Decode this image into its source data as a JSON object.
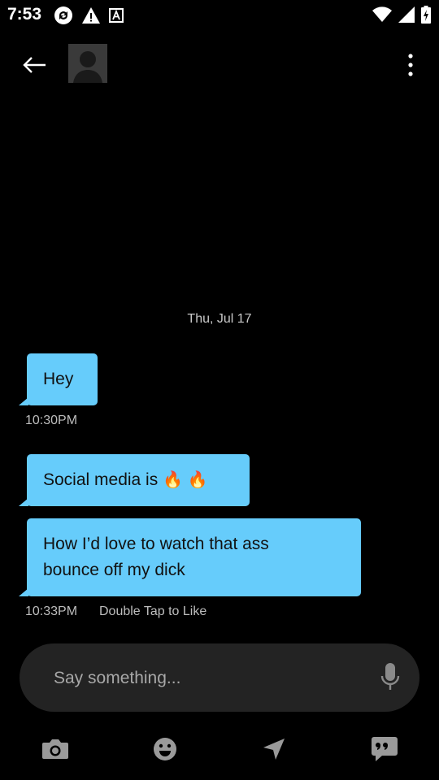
{
  "status_bar": {
    "time": "7:53"
  },
  "conversation": {
    "date": "Thu, Jul 17",
    "messages": [
      {
        "text": "Hey"
      },
      {
        "text": "Social media is",
        "emoji": "🔥 🔥"
      },
      {
        "text_line1": "How I’d love to watch that ass",
        "text_line2": "bounce off my dick"
      }
    ],
    "timestamps": [
      "10:30PM",
      "10:33PM"
    ],
    "like_hint": "Double Tap to Like"
  },
  "composer": {
    "placeholder": "Say something..."
  },
  "colors": {
    "bubble": "#66ccfb",
    "background": "#000000",
    "input": "#232323"
  }
}
